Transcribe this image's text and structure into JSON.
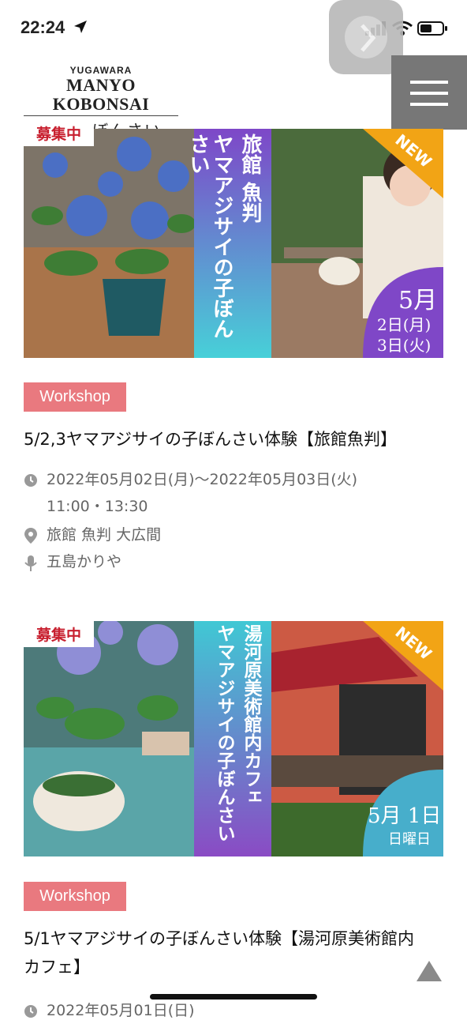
{
  "status_bar": {
    "time": "22:24"
  },
  "header": {
    "logo_line1": "YUGAWARA",
    "logo_line2": "MANYO KOBONSAI",
    "logo_line3": "万葉子ぼんさい"
  },
  "events": [
    {
      "badge": "募集中",
      "banner": {
        "venue_vertical": "旅館 魚判",
        "subtitle_vertical": "ヤマアジサイの子ぼんさい",
        "new_label": "NEW",
        "month": "5月",
        "date_line1": "2日(月)",
        "date_line2": "3日(火)"
      },
      "tag": "Workshop",
      "title": "5/2,3ヤマアジサイの子ぼんさい体験【旅館魚判】",
      "datetime": "2022年05月02日(月)〜2022年05月03日(火)",
      "time": "11:00・13:30",
      "location": "旅館 魚判 大広間",
      "instructor": "五島かりや"
    },
    {
      "badge": "募集中",
      "banner": {
        "venue_vertical": "湯河原美術館内カフェ",
        "subtitle_vertical": "ヤマアジサイの子ぼんさい",
        "new_label": "NEW",
        "date": "5月 1日",
        "weekday": "日曜日"
      },
      "tag": "Workshop",
      "title": "5/1ヤマアジサイの子ぼんさい体験【湯河原美術館内カフェ】",
      "datetime": "2022年05月01日(日)"
    }
  ],
  "colors": {
    "tag_bg": "#e9797f",
    "badge_text": "#c8202f",
    "purple": "#7f47c7",
    "cyan": "#4bd0d8",
    "orange": "#f2a415"
  }
}
